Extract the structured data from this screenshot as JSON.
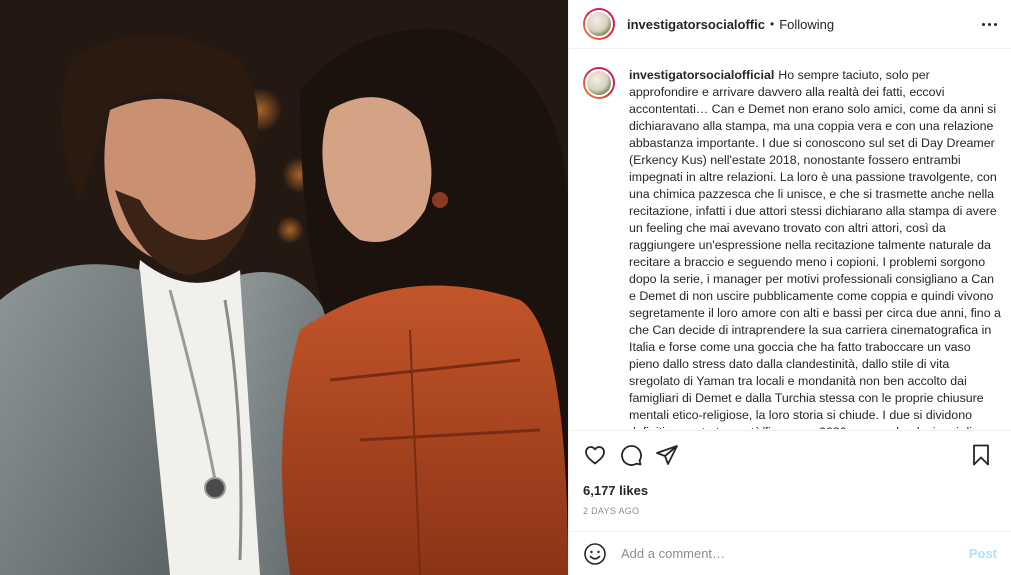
{
  "header": {
    "username": "investigatorsocialoffic",
    "separator": "•",
    "follow_status": "Following",
    "more_icon": "more-horizontal-icon"
  },
  "caption": {
    "username": "investigatorsocialofficial",
    "text": "Ho sempre taciuto, solo per approfondire e arrivare davvero alla realtà dei fatti, eccovi accontentati… Can e Demet non erano solo amici, come da anni si dichiaravano alla stampa, ma una coppia vera e con una relazione abbastanza importante. I due si conoscono sul set di Day Dreamer (Erkency Kus) nell'estate 2018, nonostante fossero entrambi impegnati in altre relazioni. La loro è una passione travolgente, con una chimica pazzesca che li unisce, e che si trasmette anche nella recitazione, infatti i due attori stessi dichiarano alla stampa di avere un feeling che mai avevano trovato con altri attori, così da raggiungere un'espressione nella recitazione talmente naturale da recitare a braccio e seguendo meno i copioni. I problemi sorgono dopo la serie, i manager per motivi professionali consigliano a Can e Demet di non uscire pubblicamente come coppia e quindi vivono segretamente il loro amore con alti e bassi per circa due anni, fino a che Can decide di intraprendere la sua carriera cinematografica in Italia e forse come una goccia che ha fatto traboccare un vaso pieno dallo stress dato dalla clandestinità, dallo stile di vita sregolato di Yaman tra locali e mondanità non ben accolto dai famigliari di Demet e dalla Turchia stessa con le proprie chiusure mentali etico-religiose, la loro storia si chiude. I due si dividono definitivamente tra metà/fine anno 2020 non perdendosi mai di"
  },
  "actions": {
    "like_icon": "heart-icon",
    "comment_icon": "comment-bubble-icon",
    "share_icon": "paper-plane-icon",
    "save_icon": "bookmark-icon"
  },
  "likes": "6,177 likes",
  "timestamp": "2 DAYS AGO",
  "comment": {
    "emoji_icon": "smiley-icon",
    "placeholder": "Add a comment…",
    "post_label": "Post"
  },
  "colors": {
    "text": "#262626",
    "muted": "#8e8e8e",
    "border": "#efefef",
    "post_disabled": "#b2dffc"
  }
}
